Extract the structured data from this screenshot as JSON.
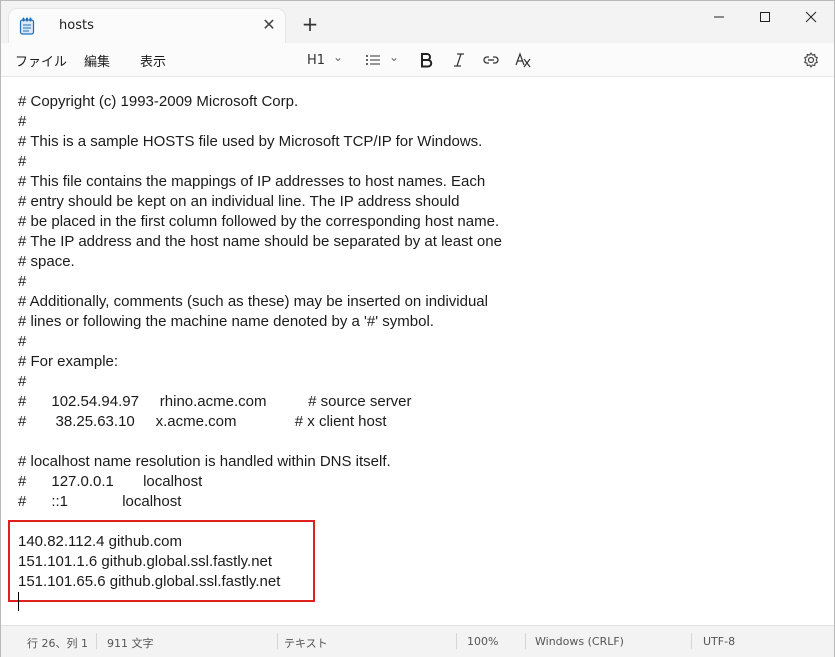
{
  "tab": {
    "title": "hosts",
    "close_glyph": "✕",
    "new_glyph": "+"
  },
  "window_controls": {
    "minimize": "—",
    "maximize": "☐",
    "close": "✕"
  },
  "menu": {
    "file": "ファイル",
    "edit": "編集",
    "view": "表示"
  },
  "toolbar": {
    "heading": "H1",
    "heading_chevron": "⌄",
    "list_chevron": "⌄"
  },
  "editor": {
    "lines": [
      "# Copyright (c) 1993-2009 Microsoft Corp.",
      "#",
      "# This is a sample HOSTS file used by Microsoft TCP/IP for Windows.",
      "#",
      "# This file contains the mappings of IP addresses to host names. Each",
      "# entry should be kept on an individual line. The IP address should",
      "# be placed in the first column followed by the corresponding host name.",
      "# The IP address and the host name should be separated by at least one",
      "# space.",
      "#",
      "# Additionally, comments (such as these) may be inserted on individual",
      "# lines or following the machine name denoted by a '#' symbol.",
      "#",
      "# For example:",
      "#",
      "#      102.54.94.97     rhino.acme.com          # source server",
      "#       38.25.63.10     x.acme.com              # x client host",
      "",
      "# localhost name resolution is handled within DNS itself.",
      "#      127.0.0.1       localhost",
      "#      ::1             localhost",
      "",
      "140.82.112.4 github.com",
      "151.101.1.6 github.global.ssl.fastly.net",
      "151.101.65.6 github.global.ssl.fastly.net",
      ""
    ]
  },
  "status": {
    "position": "行 26、列 1",
    "chars": "911 文字",
    "format": "テキスト",
    "zoom": "100%",
    "line_ending": "Windows (CRLF)",
    "encoding": "UTF-8"
  },
  "colors": {
    "highlight_border": "#e0201f",
    "titlebar": "#f3f3f3",
    "statusbar": "#f3f3f3"
  }
}
